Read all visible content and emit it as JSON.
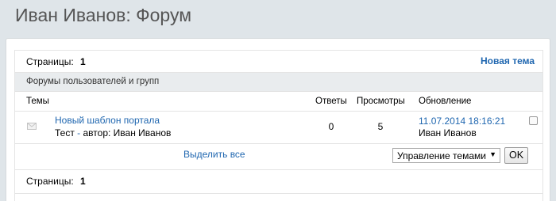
{
  "page": {
    "title": "Иван Иванов: Форум"
  },
  "pagination_top": {
    "label": "Страницы:",
    "current": "1"
  },
  "new_topic_label": "Новая тема",
  "group_title": "Форумы пользователей и групп",
  "columns": {
    "topics": "Темы",
    "replies": "Ответы",
    "views": "Просмотры",
    "updated": "Обновление"
  },
  "topics": [
    {
      "title": "Новый шаблон портала",
      "description": "Тест",
      "separator": " - ",
      "author_prefix": "автор: ",
      "author": "Иван Иванов",
      "replies": "0",
      "views": "5",
      "updated_date": "11.07.2014 18:16:21",
      "updated_by": "Иван Иванов",
      "icon": "envelope-icon"
    }
  ],
  "select_all_label": "Выделить все",
  "manage_select": {
    "value": "Управление темами"
  },
  "ok_label": "OK",
  "pagination_bottom": {
    "label": "Страницы:",
    "current": "1"
  },
  "colors": {
    "link": "#2067b0",
    "background": "#dfe5e9",
    "group_bar": "#e9ecee"
  }
}
